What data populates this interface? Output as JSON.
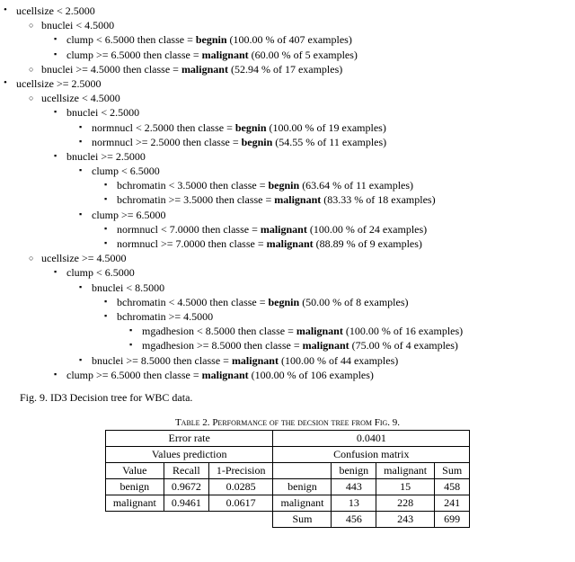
{
  "tree": {
    "n0": "ucellsize < 2.5000",
    "n0_0": "bnuclei < 4.5000",
    "n0_0_0_pre": "clump < 6.5000 then classe = ",
    "n0_0_0_cls": "begnin",
    "n0_0_0_post": " (100.00 % of 407 examples)",
    "n0_0_1_pre": "clump >= 6.5000 then classe = ",
    "n0_0_1_cls": "malignant",
    "n0_0_1_post": " (60.00 % of 5 examples)",
    "n0_1_pre": "bnuclei >= 4.5000 then classe = ",
    "n0_1_cls": "malignant",
    "n0_1_post": " (52.94 % of 17 examples)",
    "n1": "ucellsize >= 2.5000",
    "n1_0": "ucellsize < 4.5000",
    "n1_0_0": "bnuclei < 2.5000",
    "n1_0_0_0_pre": "normnucl < 2.5000 then classe = ",
    "n1_0_0_0_cls": "begnin",
    "n1_0_0_0_post": " (100.00 % of 19 examples)",
    "n1_0_0_1_pre": "normnucl >= 2.5000 then classe = ",
    "n1_0_0_1_cls": "begnin",
    "n1_0_0_1_post": " (54.55 % of 11 examples)",
    "n1_0_1": "bnuclei >= 2.5000",
    "n1_0_1_0": "clump < 6.5000",
    "n1_0_1_0_0_pre": "bchromatin < 3.5000 then classe = ",
    "n1_0_1_0_0_cls": "begnin",
    "n1_0_1_0_0_post": " (63.64 % of 11 examples)",
    "n1_0_1_0_1_pre": "bchromatin >= 3.5000 then classe = ",
    "n1_0_1_0_1_cls": "malignant",
    "n1_0_1_0_1_post": " (83.33 % of 18 examples)",
    "n1_0_1_1": "clump >= 6.5000",
    "n1_0_1_1_0_pre": "normnucl < 7.0000 then classe = ",
    "n1_0_1_1_0_cls": "malignant",
    "n1_0_1_1_0_post": " (100.00 % of 24 examples)",
    "n1_0_1_1_1_pre": "normnucl >= 7.0000 then classe = ",
    "n1_0_1_1_1_cls": "malignant",
    "n1_0_1_1_1_post": " (88.89 % of 9 examples)",
    "n1_1": "ucellsize >= 4.5000",
    "n1_1_0": "clump < 6.5000",
    "n1_1_0_0": "bnuclei < 8.5000",
    "n1_1_0_0_0_pre": "bchromatin < 4.5000 then classe = ",
    "n1_1_0_0_0_cls": "begnin",
    "n1_1_0_0_0_post": " (50.00 % of 8 examples)",
    "n1_1_0_0_1": "bchromatin >= 4.5000",
    "n1_1_0_0_1_0_pre": "mgadhesion < 8.5000 then classe = ",
    "n1_1_0_0_1_0_cls": "malignant",
    "n1_1_0_0_1_0_post": " (100.00 % of 16 examples)",
    "n1_1_0_0_1_1_pre": "mgadhesion >= 8.5000 then classe = ",
    "n1_1_0_0_1_1_cls": "malignant",
    "n1_1_0_0_1_1_post": " (75.00 % of 4 examples)",
    "n1_1_0_1_pre": "bnuclei >= 8.5000 then classe = ",
    "n1_1_0_1_cls": "malignant",
    "n1_1_0_1_post": " (100.00 % of 44 examples)",
    "n1_1_1_pre": "clump >= 6.5000 then classe = ",
    "n1_1_1_cls": "malignant",
    "n1_1_1_post": " (100.00 % of 106 examples)"
  },
  "fig_caption": "Fig. 9. ID3 Decision tree for WBC data.",
  "table_title_pre": "Table 2. ",
  "table_title": "Performance of the decsion tree from Fig. 9.",
  "table": {
    "errorrate_label": "Error rate",
    "errorrate_value": "0.0401",
    "valpred_label": "Values prediction",
    "confmat_label": "Confusion matrix",
    "h_value": "Value",
    "h_recall": "Recall",
    "h_1prec": "1-Precision",
    "h_benign": "benign",
    "h_malignant": "malignant",
    "h_sum": "Sum",
    "r_benign": "benign",
    "r_benign_recall": "0.9672",
    "r_benign_1prec": "0.0285",
    "c_benign_benign": "443",
    "c_benign_malignant": "15",
    "c_benign_sum": "458",
    "r_malignant": "malignant",
    "r_malignant_recall": "0.9461",
    "r_malignant_1prec": "0.0617",
    "c_malignant_benign": "13",
    "c_malignant_malignant": "228",
    "c_malignant_sum": "241",
    "c_sum_label": "Sum",
    "c_sum_benign": "456",
    "c_sum_malignant": "243",
    "c_sum_total": "699"
  }
}
